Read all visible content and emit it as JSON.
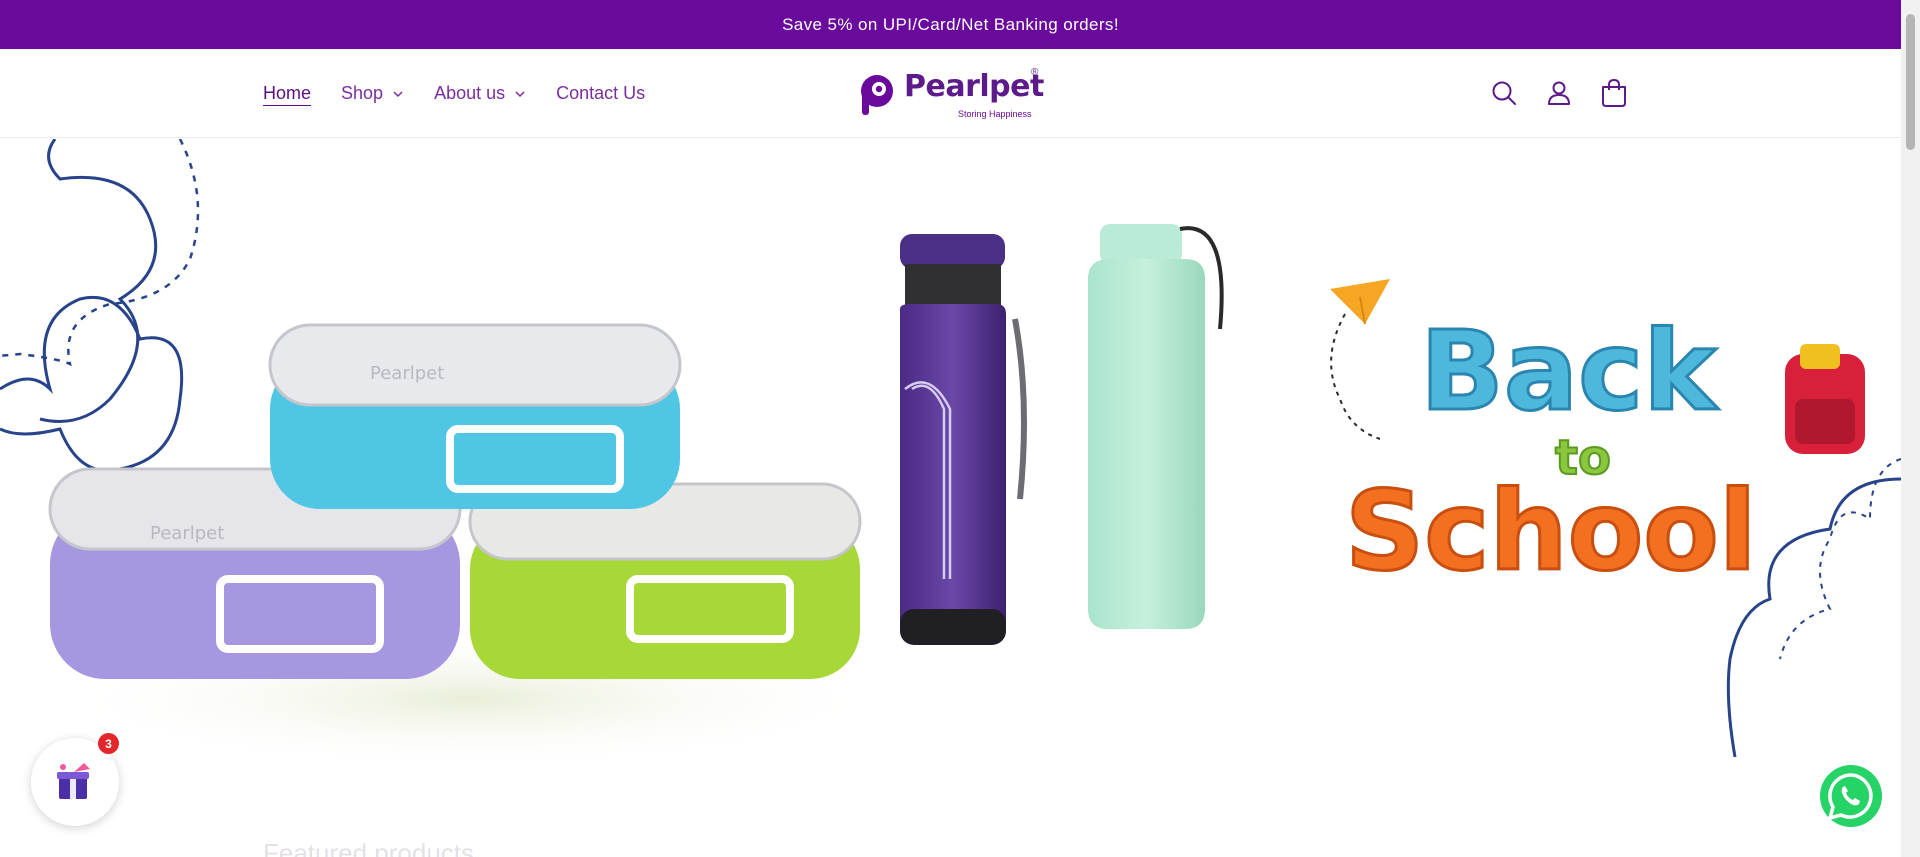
{
  "announcement": {
    "text": "Save 5% on UPI/Card/Net Banking orders!"
  },
  "nav": {
    "items": [
      {
        "label": "Home",
        "active": true,
        "dropdown": false
      },
      {
        "label": "Shop",
        "active": false,
        "dropdown": true
      },
      {
        "label": "About us",
        "active": false,
        "dropdown": true
      },
      {
        "label": "Contact Us",
        "active": false,
        "dropdown": false
      }
    ]
  },
  "logo": {
    "name": "Pearlpet",
    "registered": "®",
    "tagline": "Storing Happiness"
  },
  "header_icons": [
    "search-icon",
    "account-icon",
    "cart-icon"
  ],
  "hero": {
    "headline_word_1": "Back",
    "headline_word_2": "to",
    "headline_word_3": "School",
    "product_brand_text": "Pearlpet"
  },
  "floating": {
    "gift_badge_count": "3",
    "whatsapp_icon": "whatsapp-icon",
    "gift_icon": "gift-box-icon"
  },
  "section": {
    "title": "Featured products"
  },
  "colors": {
    "brand_purple": "#6a0a9c",
    "nav_text": "#7a2e9e",
    "badge_red": "#e3262b",
    "whatsapp_green": "#25d366"
  }
}
